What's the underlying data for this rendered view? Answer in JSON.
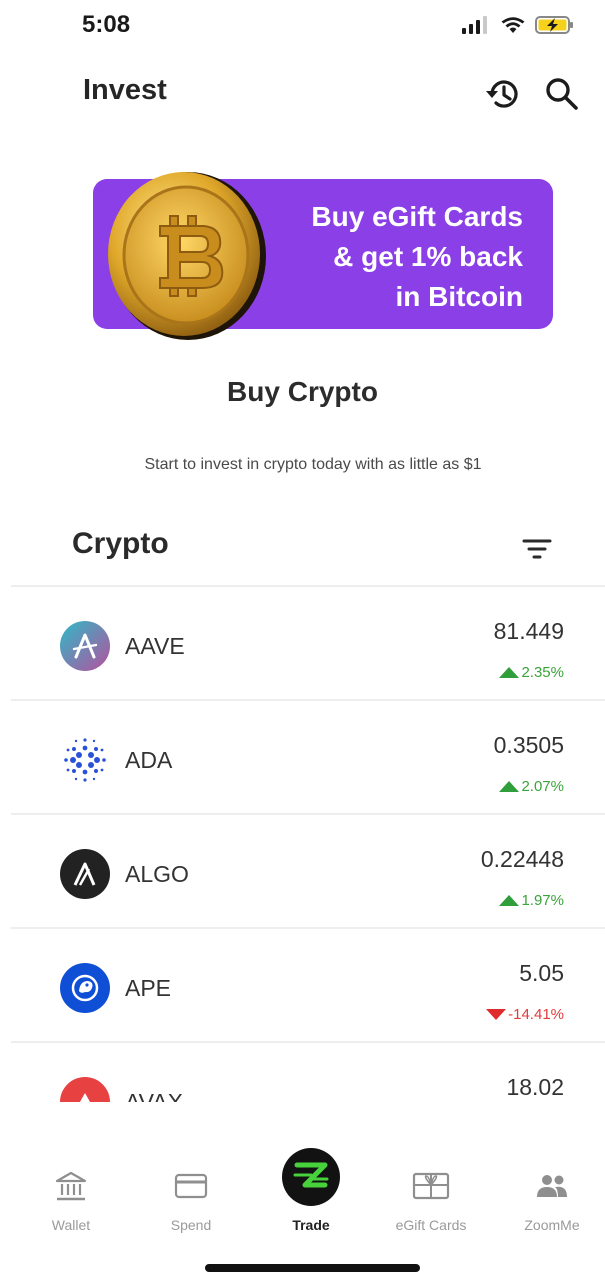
{
  "status_bar": {
    "time": "5:08",
    "icons": [
      "cellular-signal-icon",
      "wifi-icon",
      "battery-charging-icon"
    ]
  },
  "header": {
    "title": "Invest",
    "history_icon": "history-icon",
    "search_icon": "search-icon"
  },
  "banner": {
    "line1": "Buy eGift Cards",
    "line2": "& get 1% back",
    "line3": "in Bitcoin",
    "background": "#8b3fe6",
    "coin_icon": "bitcoin-coin-icon"
  },
  "buy_crypto": {
    "title": "Buy Crypto",
    "subtitle": "Start to invest in crypto today with as little as $1"
  },
  "crypto_list": {
    "title": "Crypto",
    "filter_icon": "filter-icon",
    "items": [
      {
        "symbol": "AAVE",
        "price": "81.449",
        "change": "2.35%",
        "direction": "up",
        "icon": "aave-logo-icon"
      },
      {
        "symbol": "ADA",
        "price": "0.3505",
        "change": "2.07%",
        "direction": "up",
        "icon": "cardano-logo-icon"
      },
      {
        "symbol": "ALGO",
        "price": "0.22448",
        "change": "1.97%",
        "direction": "up",
        "icon": "algorand-logo-icon"
      },
      {
        "symbol": "APE",
        "price": "5.05",
        "change": "-14.41%",
        "direction": "down",
        "icon": "apecoin-logo-icon"
      },
      {
        "symbol": "AVAX",
        "price": "18.02",
        "change": "",
        "direction": "",
        "icon": "avalanche-logo-icon"
      }
    ]
  },
  "tabbar": {
    "tabs": [
      {
        "label": "Wallet",
        "icon": "bank-icon"
      },
      {
        "label": "Spend",
        "icon": "card-icon"
      },
      {
        "label": "Trade",
        "icon": "zoom-z-icon",
        "active": true
      },
      {
        "label": "eGift Cards",
        "icon": "gift-card-icon"
      },
      {
        "label": "ZoomMe",
        "icon": "people-icon"
      }
    ]
  },
  "colors": {
    "up": "#3aa43a",
    "down": "#e23b3b",
    "accent": "#8b3fe6",
    "trade_green": "#47d23c"
  }
}
